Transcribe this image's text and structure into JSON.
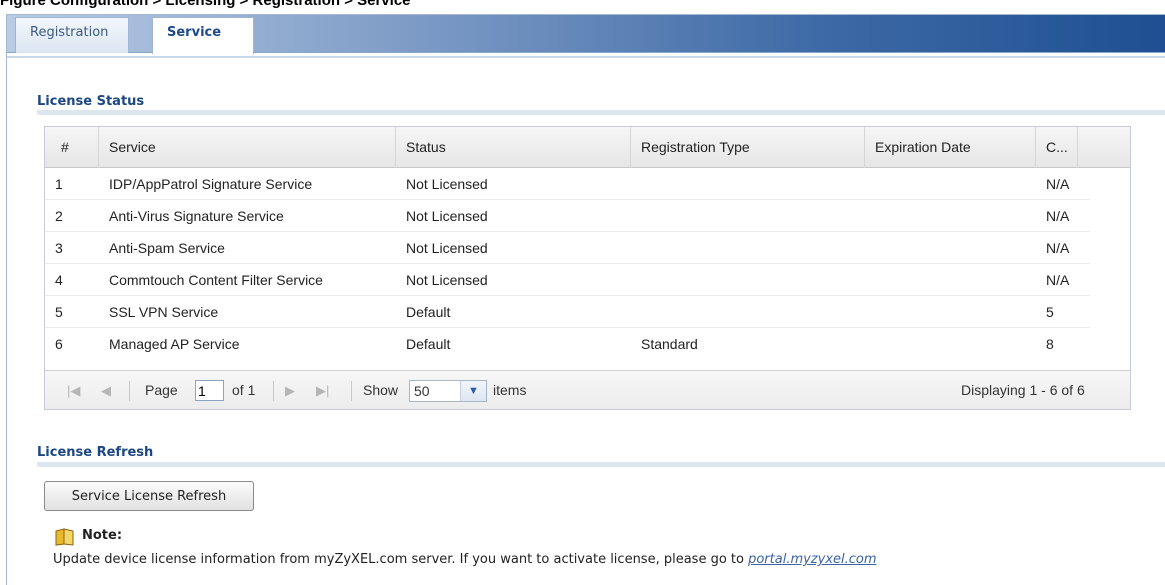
{
  "caption": "Figure  Configuration > Licensing > Registration > Service",
  "tabs": [
    {
      "label": "Registration"
    },
    {
      "label": "Service"
    }
  ],
  "license_status": {
    "title": "License Status",
    "columns": [
      "#",
      "Service",
      "Status",
      "Registration Type",
      "Expiration Date",
      "C..."
    ],
    "rows": [
      {
        "num": "1",
        "service": "IDP/AppPatrol Signature Service",
        "status": "Not Licensed",
        "reg_type": "",
        "expiration": "",
        "count": "N/A"
      },
      {
        "num": "2",
        "service": "Anti-Virus Signature Service",
        "status": "Not Licensed",
        "reg_type": "",
        "expiration": "",
        "count": "N/A"
      },
      {
        "num": "3",
        "service": "Anti-Spam Service",
        "status": "Not Licensed",
        "reg_type": "",
        "expiration": "",
        "count": "N/A"
      },
      {
        "num": "4",
        "service": "Commtouch Content Filter Service",
        "status": "Not Licensed",
        "reg_type": "",
        "expiration": "",
        "count": "N/A"
      },
      {
        "num": "5",
        "service": "SSL VPN Service",
        "status": "Default",
        "reg_type": "",
        "expiration": "",
        "count": "5"
      },
      {
        "num": "6",
        "service": "Managed AP Service",
        "status": "Default",
        "reg_type": "Standard",
        "expiration": "",
        "count": "8"
      }
    ],
    "pager": {
      "page_label": "Page",
      "page_value": "1",
      "of_label": "of 1",
      "show_label": "Show",
      "show_value": "50",
      "items_label": "items",
      "displaying": "Displaying 1 - 6 of 6"
    }
  },
  "license_refresh": {
    "title": "License Refresh",
    "button_label": "Service License Refresh"
  },
  "note": {
    "label": "Note:",
    "text": "Update device license information from myZyXEL.com server. If you want to activate license, please go to ",
    "link": "portal.myzyxel.com"
  },
  "colors": {
    "section_title": "#1c4783",
    "link": "#3b63a8",
    "tab_gradient_end": "#1f4f92"
  },
  "icons": [
    "first-page-icon",
    "prev-page-icon",
    "next-page-icon",
    "last-page-icon",
    "dropdown-arrow-icon",
    "note-book-icon"
  ]
}
